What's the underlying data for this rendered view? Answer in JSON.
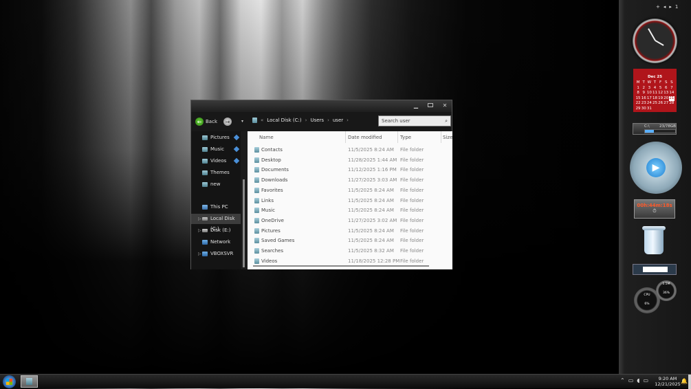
{
  "window": {
    "controls": {
      "minimize": "—",
      "maximize": "▢",
      "close": "✕"
    },
    "nav": {
      "back_label": "Back",
      "forward_icon": "→",
      "recent_icon": "▾"
    },
    "breadcrumb": {
      "items": [
        "Local Disk (C:)",
        "Users",
        "user"
      ],
      "separator": "›"
    },
    "search": {
      "placeholder": "Search user",
      "icon": "search-icon"
    },
    "nav_pane": [
      {
        "label": "Pictures",
        "pinned": true
      },
      {
        "label": "Music",
        "pinned": true
      },
      {
        "label": "Videos",
        "pinned": true
      },
      {
        "label": "Themes",
        "pinned": false
      },
      {
        "label": "new",
        "pinned": false
      },
      {
        "label": "This PC",
        "pinned": false
      },
      {
        "label": "Local Disk (C:)",
        "pinned": false,
        "selected": true
      },
      {
        "label": "Disk (E:)",
        "pinned": false
      },
      {
        "label": "Network",
        "pinned": false
      },
      {
        "label": "VBOXSVR",
        "pinned": false
      }
    ],
    "columns": {
      "name": "Name",
      "date": "Date modified",
      "type": "Type",
      "size": "Size"
    },
    "files": [
      {
        "name": "Contacts",
        "date": "11/5/2025 8:24 AM",
        "type": "File folder"
      },
      {
        "name": "Desktop",
        "date": "11/28/2025 1:44 AM",
        "type": "File folder"
      },
      {
        "name": "Documents",
        "date": "11/12/2025 1:16 PM",
        "type": "File folder"
      },
      {
        "name": "Downloads",
        "date": "11/27/2025 3:03 AM",
        "type": "File folder"
      },
      {
        "name": "Favorites",
        "date": "11/5/2025 8:24 AM",
        "type": "File folder"
      },
      {
        "name": "Links",
        "date": "11/5/2025 8:24 AM",
        "type": "File folder"
      },
      {
        "name": "Music",
        "date": "11/5/2025 8:24 AM",
        "type": "File folder"
      },
      {
        "name": "OneDrive",
        "date": "11/27/2025 3:02 AM",
        "type": "File folder"
      },
      {
        "name": "Pictures",
        "date": "11/5/2025 8:24 AM",
        "type": "File folder"
      },
      {
        "name": "Saved Games",
        "date": "11/5/2025 8:24 AM",
        "type": "File folder"
      },
      {
        "name": "Searches",
        "date": "11/5/2025 8:32 AM",
        "type": "File folder"
      },
      {
        "name": "Videos",
        "date": "11/18/2025 12:28 PM",
        "type": "File folder"
      }
    ]
  },
  "sidebar": {
    "controls": [
      "+",
      "◂",
      "▸",
      "1"
    ],
    "calendar": {
      "month": "Dec 25",
      "weekdays": [
        "M",
        "T",
        "W",
        "T",
        "F",
        "S",
        "S"
      ],
      "days": [
        "1",
        "2",
        "3",
        "4",
        "5",
        "6",
        "7",
        "8",
        "9",
        "10",
        "11",
        "12",
        "13",
        "14",
        "15",
        "16",
        "17",
        "18",
        "19",
        "20",
        "21",
        "22",
        "23",
        "24",
        "25",
        "26",
        "27",
        "28",
        "29",
        "30",
        "31"
      ],
      "today": "21"
    },
    "drive": {
      "label": "C:\\",
      "usage": "23/78GB",
      "used_fraction": 0.29
    },
    "timer": {
      "time": "00h:44m:18s",
      "icon": "⏱"
    },
    "cpu": {
      "cpu_label": "CPU",
      "cpu_value": "6%",
      "mem_value": "36%",
      "mem_top": "1.5M"
    }
  },
  "taskbar": {
    "tray_icons": [
      "up-arrow-icon",
      "network-icon",
      "volume-icon",
      "battery-icon"
    ],
    "tray_glyphs": [
      "⌃",
      "▭",
      "◖",
      "▭"
    ],
    "time": "9:20 AM",
    "date": "12/21/2025",
    "notification_glyph": "🔔"
  }
}
